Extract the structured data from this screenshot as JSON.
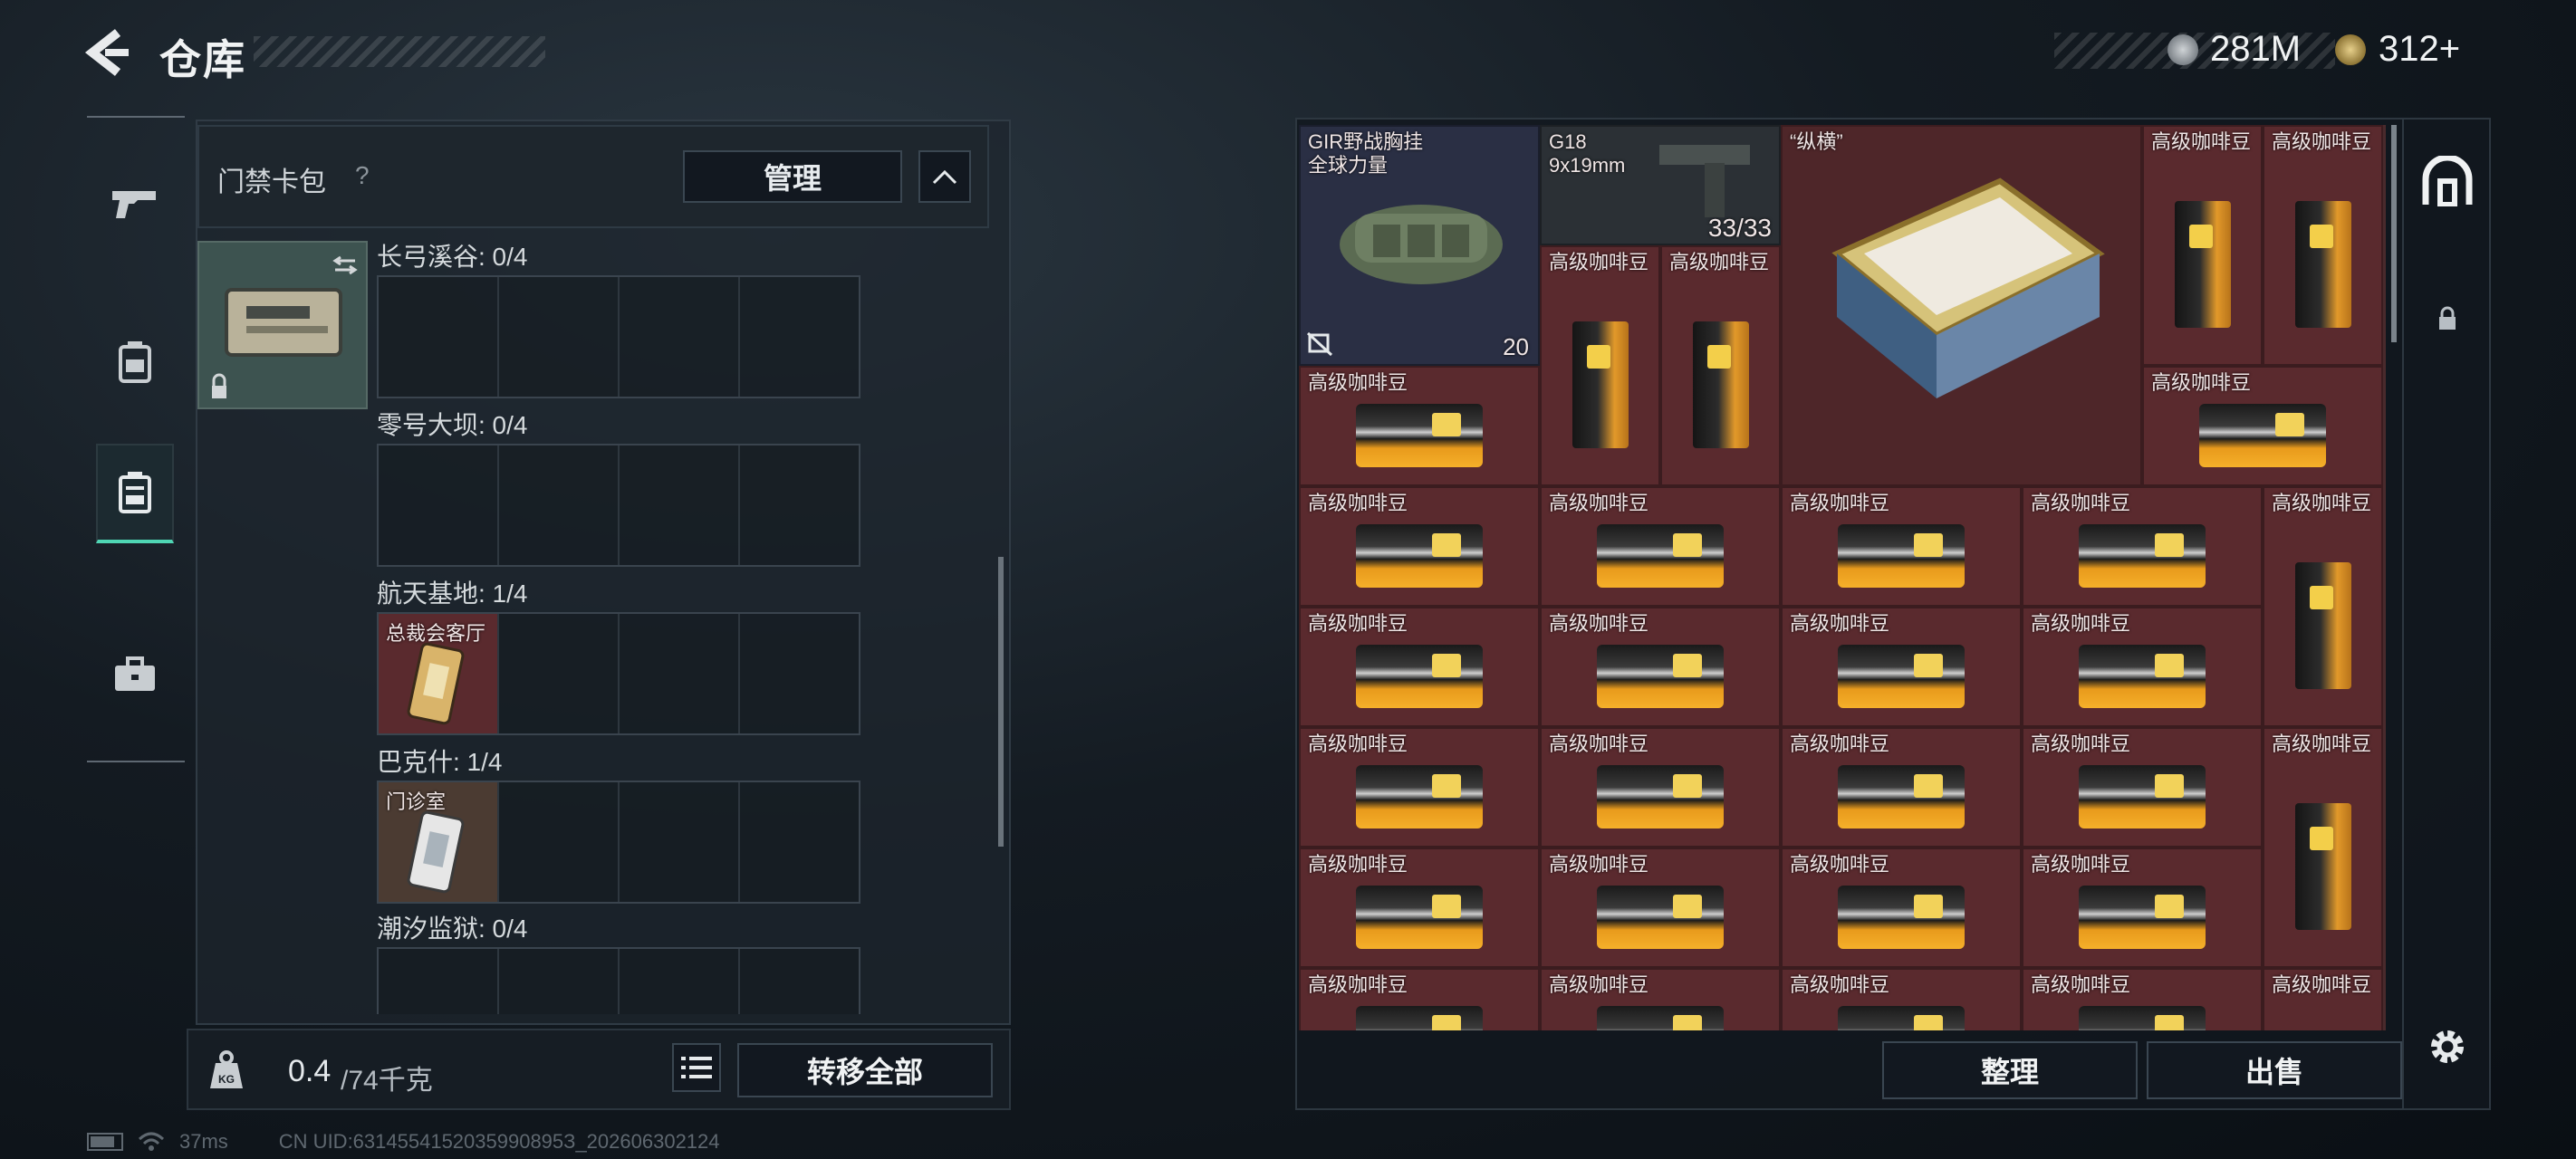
{
  "header": {
    "title": "仓库",
    "currency": [
      {
        "icon": "silver-coin-icon",
        "value": "281M"
      },
      {
        "icon": "gold-coin-icon",
        "value": "312+"
      }
    ]
  },
  "nav": {
    "items": [
      {
        "name": "weapons",
        "icon": "gun-icon"
      },
      {
        "name": "armor",
        "icon": "backpack-armor-icon"
      },
      {
        "name": "bag",
        "icon": "bag-icon",
        "active": true
      },
      {
        "name": "case",
        "icon": "briefcase-icon"
      }
    ]
  },
  "keycard_panel": {
    "title": "门禁卡包",
    "help": "?",
    "manage_label": "管理",
    "sections": [
      {
        "label": "长弓溪谷: 0/4",
        "slots": [
          null,
          null,
          null,
          null
        ]
      },
      {
        "label": "零号大坝: 0/4",
        "slots": [
          null,
          null,
          null,
          null
        ]
      },
      {
        "label": "航天基地: 1/4",
        "slots": [
          "总裁会客厅",
          null,
          null,
          null
        ]
      },
      {
        "label": "巴克什: 1/4",
        "slots": [
          "门诊室",
          null,
          null,
          null
        ]
      },
      {
        "label": "潮汐监狱: 0/4",
        "slots": [
          null,
          null,
          null,
          null
        ]
      }
    ]
  },
  "bottom_left": {
    "weight_current": "0.4",
    "weight_max": "/74千克",
    "transfer_label": "转移全部"
  },
  "status_bar": {
    "ping": "37ms",
    "uid": "CN UID:6314554152035990895З_202606302124"
  },
  "stash": {
    "bag_item": {
      "name": "GIR野战胸挂",
      "sub": "全球力量",
      "capacity": "20"
    },
    "gun_item": {
      "name": "G18",
      "ammo": "9x19mm",
      "count": "33/33"
    },
    "chess_item": {
      "name": "“纵横”"
    },
    "coffee_label": "高级咖啡豆",
    "sort_label": "整理",
    "sell_label": "出售"
  }
}
